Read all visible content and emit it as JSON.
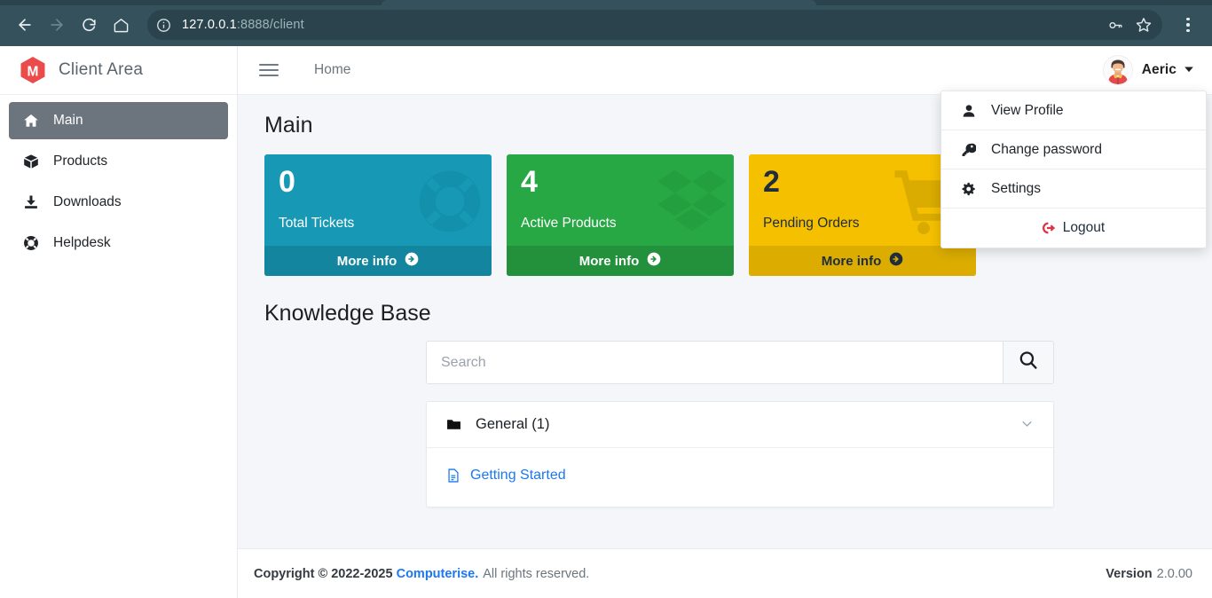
{
  "browser": {
    "url_host": "127.0.0.1",
    "url_rest": ":8888/client",
    "back_icon": "back-arrow-icon",
    "forward_icon": "forward-arrow-icon",
    "reload_icon": "reload-icon",
    "home_icon": "home-icon",
    "site_info_icon": "info-circle-icon",
    "password_icon": "key-icon",
    "bookmark_icon": "star-icon",
    "menu_icon": "three-dots-vertical-icon"
  },
  "sidebar": {
    "brand": "Client Area",
    "logo_icon": "hexagon-m-logo",
    "logo_color": "#ec4b4b",
    "items": [
      {
        "label": "Main",
        "icon": "home-icon",
        "active": true
      },
      {
        "label": "Products",
        "icon": "box-icon",
        "active": false
      },
      {
        "label": "Downloads",
        "icon": "download-icon",
        "active": false
      },
      {
        "label": "Helpdesk",
        "icon": "life-ring-icon",
        "active": false
      }
    ]
  },
  "topbar": {
    "menu_toggle_icon": "hamburger-icon",
    "breadcrumb": "Home",
    "user_name": "Aeric",
    "caret_icon": "chevron-down-icon",
    "avatar_icon": "user-avatar"
  },
  "user_dropdown": {
    "open": true,
    "items": [
      {
        "label": "View Profile",
        "icon": "user-icon"
      },
      {
        "label": "Change password",
        "icon": "key-icon"
      },
      {
        "label": "Settings",
        "icon": "gear-icon"
      }
    ],
    "logout": {
      "label": "Logout",
      "icon": "sign-out-icon",
      "color": "#dc3545"
    }
  },
  "content": {
    "page_title": "Main",
    "cards": [
      {
        "value": "0",
        "label": "Total Tickets",
        "more_info": "More info",
        "icon": "life-ring-icon",
        "color": "#1799b5",
        "footer_color": "#13859e",
        "text_color": "#ffffff"
      },
      {
        "value": "4",
        "label": "Active Products",
        "more_info": "More info",
        "icon": "dropbox-icon",
        "color": "#28a745",
        "footer_color": "#23913c",
        "text_color": "#ffffff"
      },
      {
        "value": "2",
        "label": "Pending Orders",
        "more_info": "More info",
        "icon": "shopping-cart-icon",
        "color": "#f5c000",
        "footer_color": "#dcad00",
        "text_color": "#1f2d3d"
      }
    ],
    "knowledge_base": {
      "title": "Knowledge Base",
      "search_placeholder": "Search",
      "search_value": "",
      "search_button_icon": "magnifier-icon",
      "category": {
        "label": "General (1)",
        "folder_icon": "folder-icon",
        "chevron_icon": "chevron-down-icon"
      },
      "articles": [
        {
          "label": "Getting Started",
          "icon": "document-icon"
        }
      ]
    }
  },
  "footer": {
    "copyright_strong": "Copyright © 2022-2025",
    "brand": "Computerise.",
    "rights": "All rights reserved.",
    "version_label": "Version",
    "version_number": "2.0.00"
  }
}
